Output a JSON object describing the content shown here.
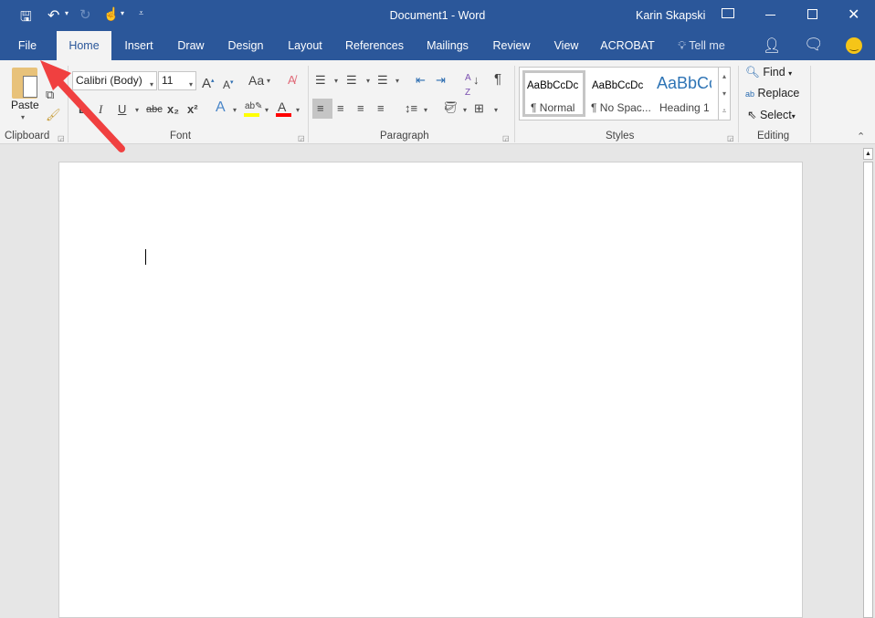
{
  "title_bar": {
    "document_title": "Document1 - Word",
    "user_name": "Karin Skapski",
    "qat": {
      "save_icon": "save-icon",
      "undo_icon": "undo-icon",
      "redo_icon": "redo-icon",
      "touch_icon": "touch-mode-icon",
      "customize_icon": "customize-icon"
    }
  },
  "tabs": [
    {
      "label": "File"
    },
    {
      "label": "Home"
    },
    {
      "label": "Insert"
    },
    {
      "label": "Draw"
    },
    {
      "label": "Design"
    },
    {
      "label": "Layout"
    },
    {
      "label": "References"
    },
    {
      "label": "Mailings"
    },
    {
      "label": "Review"
    },
    {
      "label": "View"
    },
    {
      "label": "ACROBAT"
    }
  ],
  "tell_me": "Tell me",
  "ribbon": {
    "clipboard": {
      "label": "Clipboard",
      "paste": "Paste"
    },
    "font": {
      "label": "Font",
      "font_name": "Calibri (Body)",
      "font_size": "11",
      "change_case": "Aa",
      "bold": "B",
      "italic": "I",
      "underline": "U",
      "strike": "abc",
      "subscript": "x₂",
      "superscript": "x²",
      "highlight_color": "#ffff00",
      "font_color": "#ff0000"
    },
    "paragraph": {
      "label": "Paragraph",
      "pilcrow": "¶"
    },
    "styles": {
      "label": "Styles",
      "items": [
        {
          "preview": "AaBbCcDc",
          "name": "¶ Normal"
        },
        {
          "preview": "AaBbCcDc",
          "name": "¶ No Spac..."
        },
        {
          "preview": "AaBbCc",
          "name": "Heading 1"
        }
      ]
    },
    "editing": {
      "label": "Editing",
      "find": "Find",
      "replace": "Replace",
      "select": "Select"
    }
  },
  "colors": {
    "brand": "#2b579a",
    "arrow": "#f04040"
  }
}
